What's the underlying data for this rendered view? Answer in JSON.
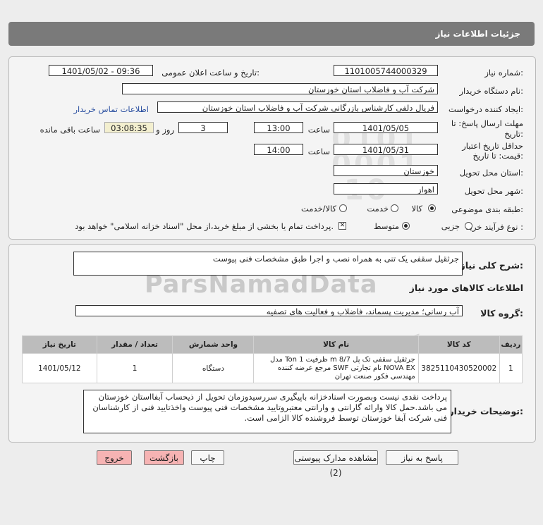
{
  "header": {
    "title": "جزئیات اطلاعات نیاز"
  },
  "form": {
    "need_number_label": "شماره نیاز:",
    "need_number": "1101005744000329",
    "announce_label": "تاریخ و ساعت اعلان عمومی:",
    "announce_value": "1401/05/02 - 09:36",
    "buyer_org_label": "نام دستگاه خریدار:",
    "buyer_org": "شرکت آب و فاضلاب استان خوزستان",
    "creator_label": "ایجاد کننده درخواست:",
    "creator": "فریال دلفی کارشناس بازرگانی شرکت آب و فاضلاب استان خوزستان",
    "contact_link": "اطلاعات تماس خریدار",
    "deadline_label_1": "مهلت ارسال پاسخ: تا",
    "deadline_label_2": "تاریخ:",
    "deadline_date": "1401/05/05",
    "time_word": "ساعت",
    "deadline_time": "13:00",
    "days": "3",
    "days_word": "روز و",
    "remaining_time": "03:08:35",
    "remaining_word": "ساعت باقی مانده",
    "validity_label_1": "حداقل تاریخ اعتبار",
    "validity_label_2": "قیمت: تا تاریخ:",
    "validity_date": "1401/05/31",
    "validity_time": "14:00",
    "province_label": "استان محل تحویل:",
    "province": "خوزستان",
    "city_label": "شهر محل تحویل:",
    "city": "اهواز",
    "category_label": "طبقه بندی موضوعی:",
    "category_options": [
      "کالا",
      "خدمت",
      "کالا/خدمت"
    ],
    "process_label": "نوع فرآیند خرید :",
    "process_options": [
      "جزیی",
      "متوسط"
    ],
    "payment_note": "پرداخت تمام یا بخشی از مبلغ خرید،از محل \"اسناد خزانه اسلامی\" خواهد بود."
  },
  "summary": {
    "label": "شرح کلی نیاز:",
    "value": "جرثقیل سقفی یک تنی به همراه نصب و اجرا طبق مشخصات فنی پیوست"
  },
  "goods_info_title": "اطلاعات کالاهای مورد نیاز",
  "goods_group": {
    "label": "گروه کالا:",
    "value": "آب رسانی؛ مدیریت پسماند، فاضلاب و فعالیت های تصفیه"
  },
  "table": {
    "headers": [
      "ردیف",
      "کد کالا",
      "نام کالا",
      "واحد شمارش",
      "تعداد / مقدار",
      "تاریخ نیاز"
    ],
    "rows": [
      {
        "row": "1",
        "code": "3825110430520002",
        "name": "جرثقیل سقفی تک پل m 8/7 ظرفیت Ton 1 مدل NOVA EX نام تجارتی SWF مرجع عرضه کننده مهندسی فکور صنعت تهران",
        "unit": "دستگاه",
        "qty": "1",
        "date": "1401/05/12"
      }
    ]
  },
  "buyer_notes": {
    "label": "توضیحات خریدار:",
    "value": "پرداخت نقدی نیست وبصورت اسنادخزانه باپیگیری سررسیدوزمان تحویل از ذیحساب آبفااستان خوزستان می باشد.حمل کالا وارائه گارانتی و وارانتی معتبروتایید مشخصات فنی پیوست واخذتایید فنی از کارشناسان فنی شرکت آبفا خوزستان توسط فروشنده کالا الزامی است."
  },
  "buttons": {
    "reply": "پاسخ به نیاز",
    "docs": "مشاهده مدارک پیوستی (2)",
    "print": "چاپ",
    "back": "بازگشت",
    "exit": "خروج"
  }
}
